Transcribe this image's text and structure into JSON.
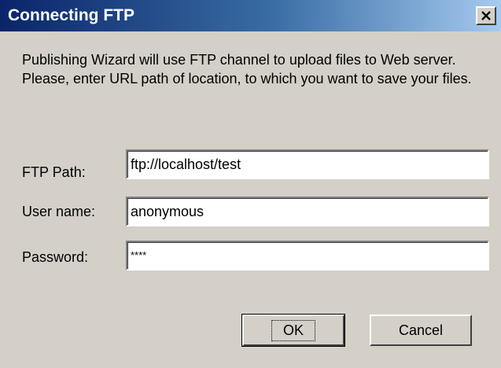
{
  "window": {
    "title": "Connecting FTP",
    "close_icon": "close-icon"
  },
  "message": "Publishing Wizard will use FTP channel to upload files to Web server. Please, enter URL path of location, to which you want to save your files.",
  "fields": {
    "ftp_path": {
      "label": "FTP Path:",
      "value": "ftp://localhost/test"
    },
    "user_name": {
      "label": "User name:",
      "value": "anonymous"
    },
    "password": {
      "label": "Password:",
      "value": "****"
    }
  },
  "buttons": {
    "ok": "OK",
    "cancel": "Cancel"
  }
}
